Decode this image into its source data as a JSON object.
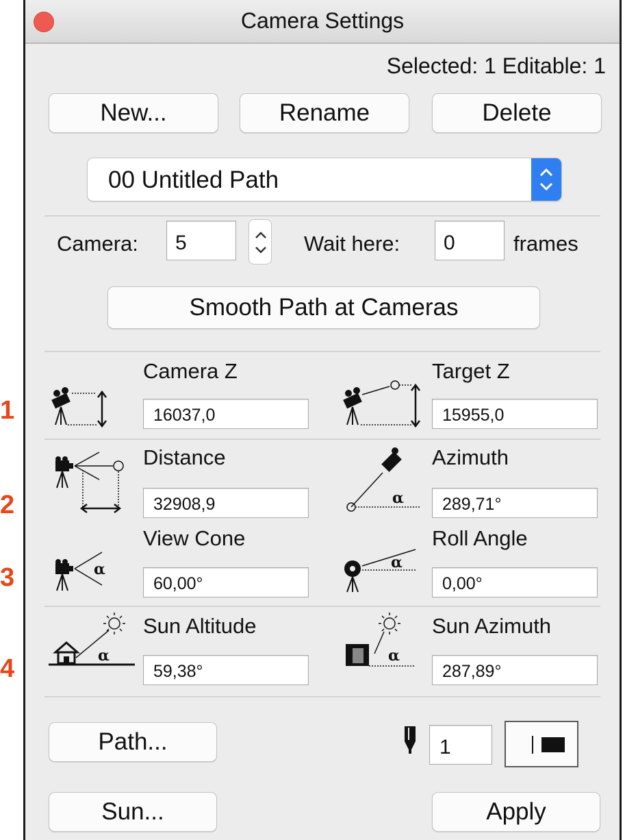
{
  "window": {
    "title": "Camera Settings"
  },
  "status": "Selected: 1 Editable: 1",
  "buttons": {
    "new": "New...",
    "rename": "Rename",
    "delete": "Delete",
    "smooth": "Smooth Path at Cameras",
    "path": "Path...",
    "sun": "Sun...",
    "apply": "Apply"
  },
  "path_select": {
    "value": "00  Untitled Path"
  },
  "camera": {
    "label": "Camera:",
    "value": "5",
    "wait_label": "Wait here:",
    "wait_value": "0",
    "frames_label": "frames"
  },
  "params": {
    "camera_z": {
      "label": "Camera Z",
      "value": "16037,0"
    },
    "target_z": {
      "label": "Target Z",
      "value": "15955,0"
    },
    "distance": {
      "label": "Distance",
      "value": "32908,9"
    },
    "azimuth": {
      "label": "Azimuth",
      "value": "289,71°"
    },
    "view_cone": {
      "label": "View Cone",
      "value": "60,00°"
    },
    "roll_angle": {
      "label": "Roll Angle",
      "value": "0,00°"
    },
    "sun_altitude": {
      "label": "Sun Altitude",
      "value": "59,38°"
    },
    "sun_azimuth": {
      "label": "Sun Azimuth",
      "value": "287,89°"
    }
  },
  "pen": {
    "value": "1"
  },
  "markers": [
    "1",
    "2",
    "3",
    "4"
  ],
  "colors": {
    "close": "#ee5a52",
    "marker": "#e8451a",
    "select_accent": "#2f7ff0"
  }
}
